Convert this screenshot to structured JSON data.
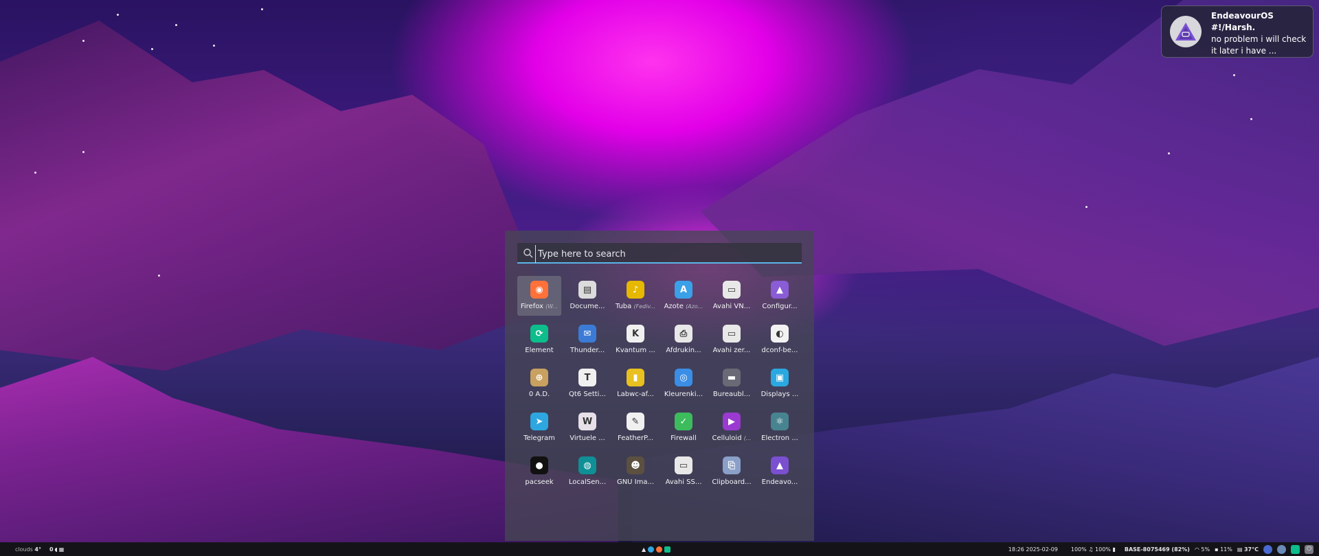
{
  "notification": {
    "title": "EndeavourOS\n#!/Harsh.",
    "body": "no problem i will check it later i have ..."
  },
  "launcher": {
    "search_placeholder": "Type here to search",
    "apps": [
      {
        "label": "Firefox",
        "sub": "(W...",
        "icon": "firefox-icon",
        "color": "#ff7139",
        "glyph": "◉",
        "selected": true
      },
      {
        "label": "Docume...",
        "icon": "document-viewer-icon",
        "color": "#dcdcdc",
        "glyph": "▤"
      },
      {
        "label": "Tuba",
        "sub": "(Fediv...",
        "icon": "tuba-icon",
        "color": "#e6b800",
        "glyph": "♪"
      },
      {
        "label": "Azote",
        "sub": "(Azo...",
        "icon": "azote-icon",
        "color": "#3aa0e8",
        "glyph": "A"
      },
      {
        "label": "Avahi VN...",
        "icon": "avahi-vnc-icon",
        "color": "#e8e8e8",
        "glyph": "▭"
      },
      {
        "label": "Configur...",
        "icon": "endeavour-config-icon",
        "color": "#8a5cd6",
        "glyph": "▲"
      },
      {
        "label": "Element",
        "icon": "element-icon",
        "color": "#0dbd8b",
        "glyph": "⟳"
      },
      {
        "label": "Thunder...",
        "icon": "thunderbird-icon",
        "color": "#3b7bd6",
        "glyph": "✉"
      },
      {
        "label": "Kvantum ...",
        "icon": "kvantum-icon",
        "color": "#f0f0f0",
        "glyph": "K"
      },
      {
        "label": "Afdrukin...",
        "icon": "printer-icon",
        "color": "#e8e8e8",
        "glyph": "⎙"
      },
      {
        "label": "Avahi zer...",
        "icon": "avahi-zeroconf-icon",
        "color": "#e8e8e8",
        "glyph": "▭"
      },
      {
        "label": "dconf-be...",
        "icon": "dconf-editor-icon",
        "color": "#f2f2f2",
        "glyph": "◐"
      },
      {
        "label": "0 A.D.",
        "icon": "zero-ad-icon",
        "color": "#c8a060",
        "glyph": "⊕"
      },
      {
        "label": "Qt6 Setti...",
        "icon": "qt6-settings-icon",
        "color": "#f0f0f0",
        "glyph": "T"
      },
      {
        "label": "Labwc-af...",
        "icon": "labwc-icon",
        "color": "#e8c020",
        "glyph": "▮"
      },
      {
        "label": "Kleurenki...",
        "icon": "color-picker-icon",
        "color": "#3a8ee6",
        "glyph": "◎"
      },
      {
        "label": "Bureaubl...",
        "icon": "desktop-icon",
        "color": "#6a6a76",
        "glyph": "▬"
      },
      {
        "label": "Displays ...",
        "icon": "displays-icon",
        "color": "#2aa8e0",
        "glyph": "▣"
      },
      {
        "label": "Telegram",
        "icon": "telegram-icon",
        "color": "#2ea6e0",
        "glyph": "➤"
      },
      {
        "label": "Virtuele ...",
        "icon": "virtual-machine-icon",
        "color": "#e8e0e8",
        "glyph": "W"
      },
      {
        "label": "FeatherP...",
        "icon": "featherpad-icon",
        "color": "#f0f0f0",
        "glyph": "✎"
      },
      {
        "label": "Firewall",
        "icon": "firewall-icon",
        "color": "#3cbc5c",
        "glyph": "✓"
      },
      {
        "label": "Celluloid",
        "sub": "(...",
        "icon": "celluloid-icon",
        "color": "#9a3ad0",
        "glyph": "▶"
      },
      {
        "label": "Electron ...",
        "icon": "electron-icon",
        "color": "#47848f",
        "glyph": "⚛"
      },
      {
        "label": "pacseek",
        "icon": "pacseek-icon",
        "color": "#111111",
        "glyph": "●"
      },
      {
        "label": "LocalSen...",
        "icon": "localsend-icon",
        "color": "#0f8f96",
        "glyph": "◍"
      },
      {
        "label": "GNU Ima...",
        "icon": "gimp-icon",
        "color": "#5c5040",
        "glyph": "☻"
      },
      {
        "label": "Avahi SS...",
        "icon": "avahi-ssh-icon",
        "color": "#e8e8e8",
        "glyph": "▭"
      },
      {
        "label": "Clipboard...",
        "icon": "clipboard-icon",
        "color": "#8aa0c8",
        "glyph": "⎘"
      },
      {
        "label": "Endeavo...",
        "icon": "endeavouros-icon",
        "color": "#7a50d0",
        "glyph": "▲"
      }
    ]
  },
  "taskbar": {
    "weather_label": "clouds",
    "weather_temp": "4°",
    "workspace": "0",
    "clock": "18:26 2025-02-09",
    "volume": "100%",
    "mic": "100%",
    "battery": "BASE-8075469 (82%)",
    "wifi": "5%",
    "cpu": "11%",
    "temperature": "37°C"
  }
}
